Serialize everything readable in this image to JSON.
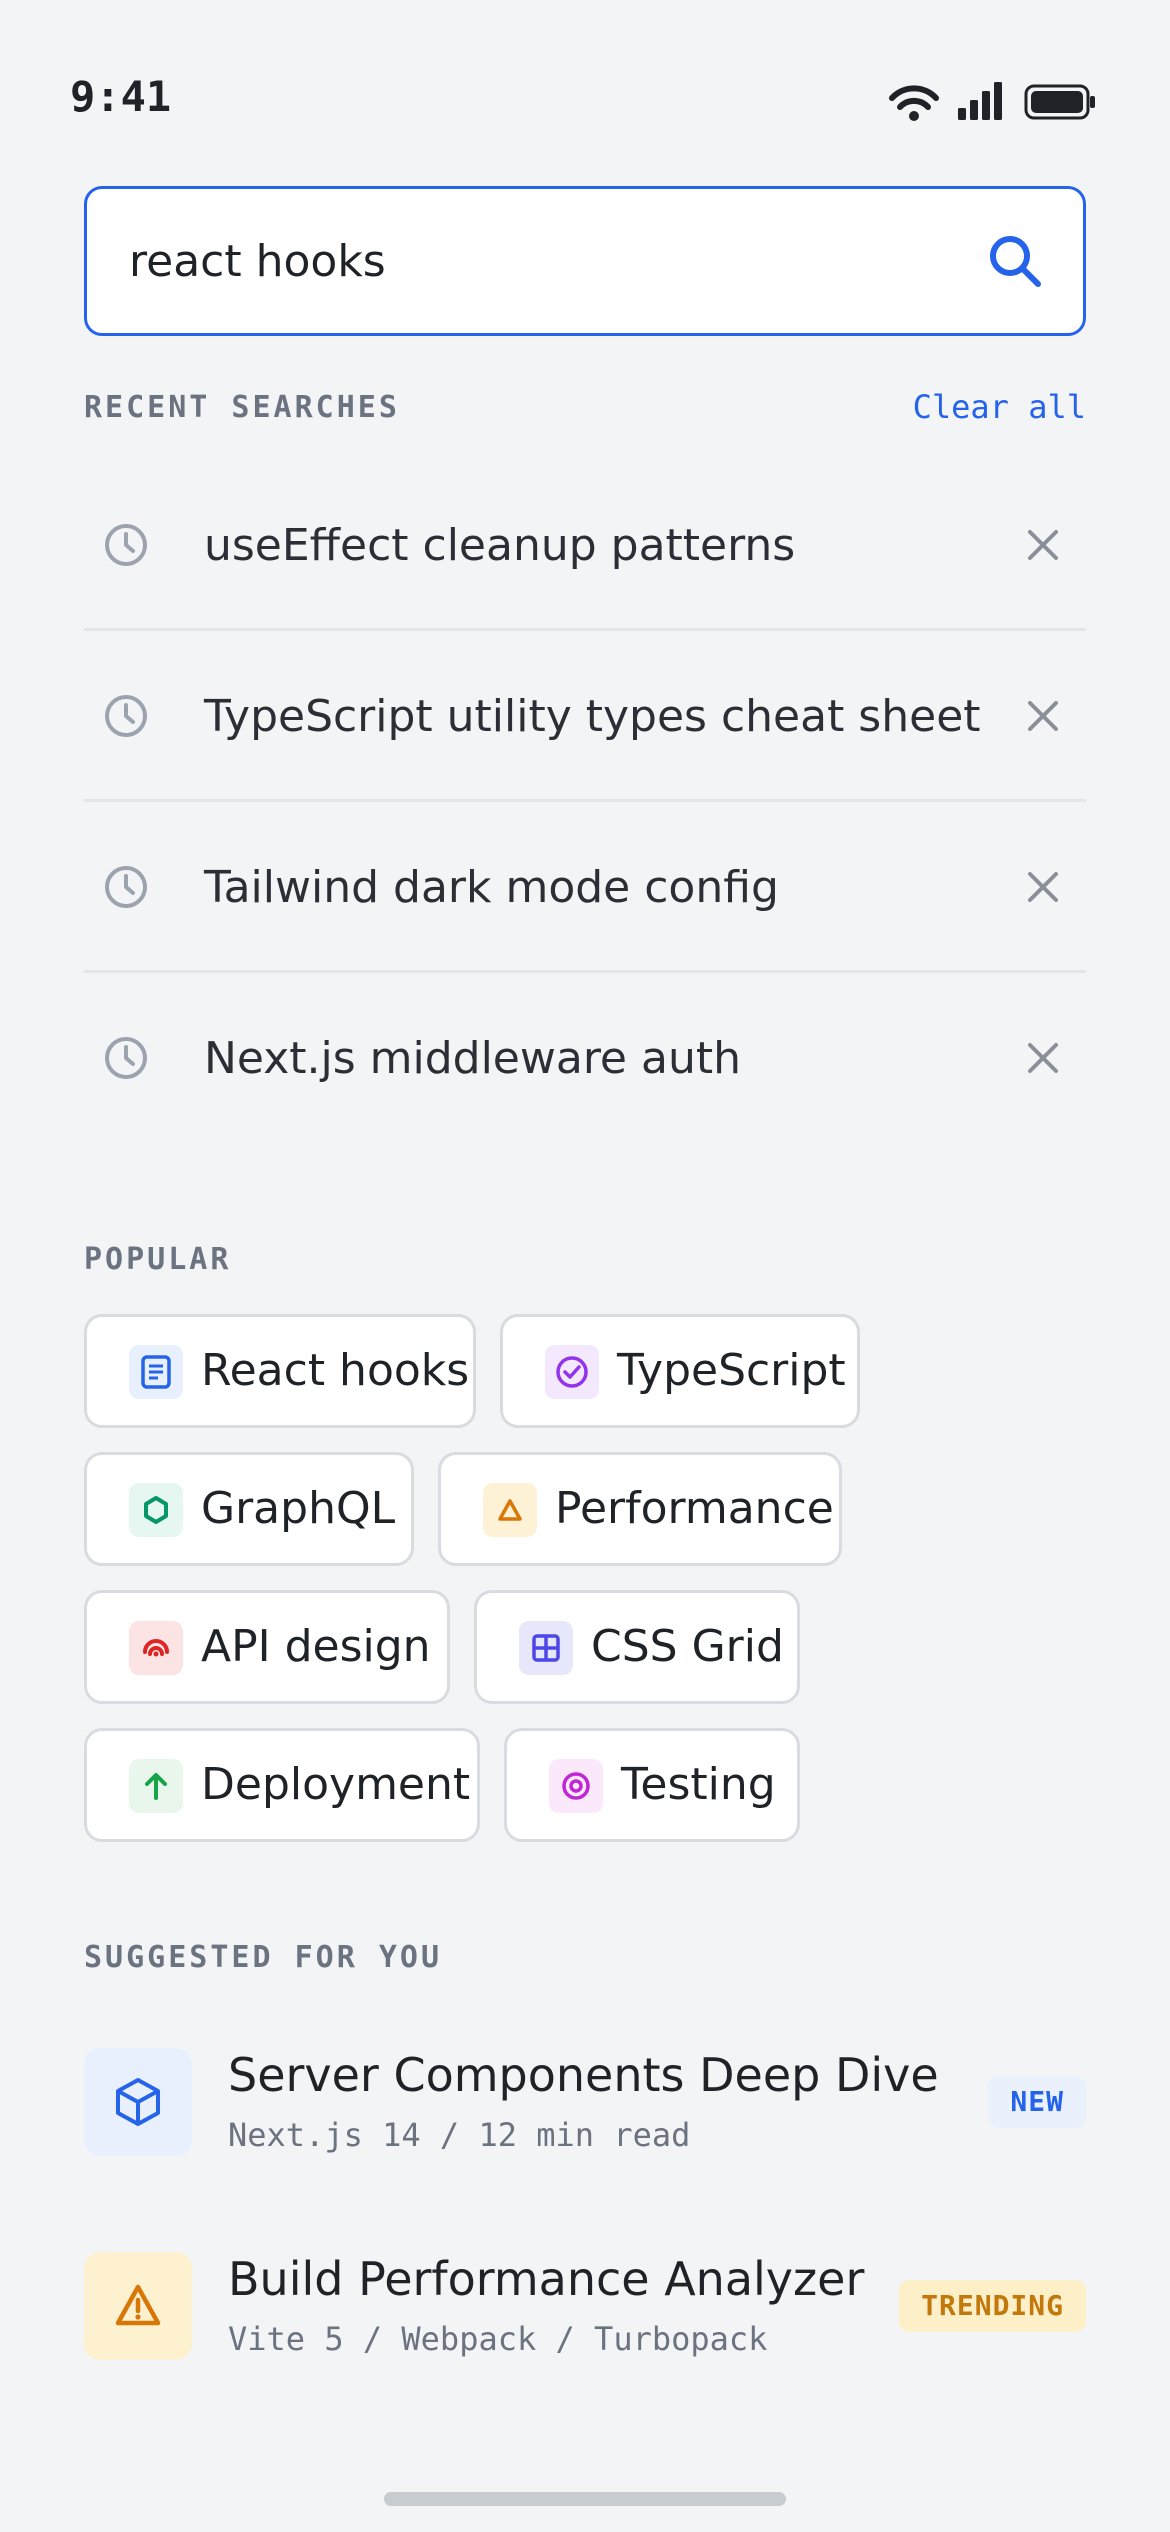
{
  "status_bar": {
    "time": "9:41"
  },
  "search": {
    "value": "react hooks",
    "placeholder": "Search"
  },
  "recent": {
    "heading": "RECENT SEARCHES",
    "clear_label": "Clear all",
    "items": [
      {
        "label": "useEffect cleanup patterns"
      },
      {
        "label": "TypeScript utility types cheat sheet"
      },
      {
        "label": "Tailwind dark mode config"
      },
      {
        "label": "Next.js middleware auth"
      }
    ]
  },
  "popular": {
    "heading": "POPULAR",
    "chips": [
      {
        "label": "React hooks",
        "icon": "document-icon",
        "color": "#2563eb",
        "bg": "#e8effd"
      },
      {
        "label": "TypeScript",
        "icon": "check-circle-icon",
        "color": "#9333ea",
        "bg": "#f3e8fd"
      },
      {
        "label": "GraphQL",
        "icon": "hexagon-icon",
        "color": "#059669",
        "bg": "#e6f6f0"
      },
      {
        "label": "Performance",
        "icon": "warning-triangle-icon",
        "color": "#d97706",
        "bg": "#fdf1d6"
      },
      {
        "label": "API design",
        "icon": "signal-arc-icon",
        "color": "#dc2626",
        "bg": "#fde4e4"
      },
      {
        "label": "CSS Grid",
        "icon": "grid-icon",
        "color": "#4f46e5",
        "bg": "#e6e7fb"
      },
      {
        "label": "Deployment",
        "icon": "arrow-up-icon",
        "color": "#16a34a",
        "bg": "#e8f6ec"
      },
      {
        "label": "Testing",
        "icon": "target-icon",
        "color": "#c026d3",
        "bg": "#fbe9fb"
      }
    ]
  },
  "suggested": {
    "heading": "SUGGESTED FOR YOU",
    "items": [
      {
        "title": "Server Components Deep Dive",
        "subtitle": "Next.js 14 / 12 min read",
        "badge": "NEW",
        "icon": "cube-icon",
        "color": "#2563eb",
        "bg": "#e8effd",
        "badge_color": "#2563eb",
        "badge_bg": "#eaf0fc"
      },
      {
        "title": "Build Performance Analyzer",
        "subtitle": "Vite 5 / Webpack / Turbopack",
        "badge": "TRENDING",
        "icon": "warning-triangle-icon",
        "color": "#d97706",
        "bg": "#fdf1d0",
        "badge_color": "#c2780a",
        "badge_bg": "#fdf0c9"
      }
    ]
  }
}
